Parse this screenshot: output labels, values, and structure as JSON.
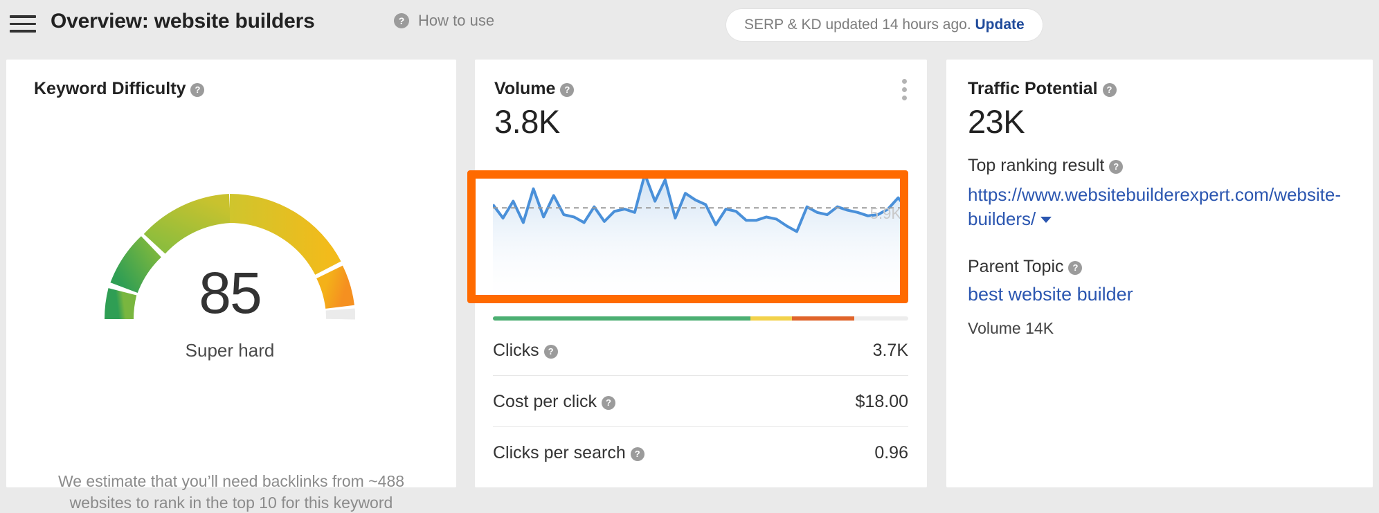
{
  "header": {
    "menu_icon": "hamburger-icon",
    "title": "Overview: website builders",
    "help_icon": "question-mark-icon",
    "how_to_use": "How to use",
    "update_text": "SERP & KD updated 14 hours ago.",
    "update_link": "Update",
    "update_link_color": "#204b9b"
  },
  "keyword_difficulty": {
    "title": "Keyword Difficulty",
    "help_icon": "question-mark-icon",
    "score": "85",
    "score_label": "Super hard",
    "footer": "We estimate that you’ll need backlinks from ~488 websites to rank in the top 10 for this keyword",
    "gauge": {
      "value": 85,
      "min": 0,
      "max": 100,
      "colors": [
        "#3da35c",
        "#8dbf3f",
        "#d4c32c",
        "#f2b619",
        "#f5971d",
        "#ebebeb"
      ]
    }
  },
  "volume": {
    "title": "Volume",
    "help_icon": "question-mark-icon",
    "value": "3.8K",
    "menu_icon": "kebab-menu-icon",
    "axis_max_label": "5.9K",
    "serp_segments": [
      {
        "color": "#4caf72",
        "pct": 62
      },
      {
        "color": "#f2d24b",
        "pct": 10
      },
      {
        "color": "#e0642a",
        "pct": 15
      },
      {
        "color": "#ededed",
        "pct": 13
      }
    ],
    "metrics": [
      {
        "label": "Clicks",
        "value": "3.7K",
        "help_icon": "question-mark-icon"
      },
      {
        "label": "Cost per click",
        "value": "$18.00",
        "help_icon": "question-mark-icon"
      },
      {
        "label": "Clicks per search",
        "value": "0.96",
        "help_icon": "question-mark-icon"
      }
    ]
  },
  "traffic_potential": {
    "title": "Traffic Potential",
    "help_icon": "question-mark-icon",
    "value": "23K",
    "top_ranking_result_label": "Top ranking result",
    "top_ranking_result_url": "https://www.websitebuilderexpert.com/website-builders/",
    "dropdown_icon": "caret-down-icon",
    "parent_topic_label": "Parent Topic",
    "parent_topic": "best website builder",
    "parent_volume": "Volume 14K"
  },
  "annotation": {
    "name": "highlight-box",
    "color": "#ff6a00"
  },
  "chart_data": {
    "type": "area",
    "title": "Volume",
    "ylabel": "",
    "xlabel": "",
    "ylim": [
      0,
      5900
    ],
    "axis_max_label": "5.9K",
    "average_line": 3800,
    "line_color": "#4a90d9",
    "fill_color": "#dce9f7",
    "grid": false,
    "legend": null,
    "values": [
      3950,
      3350,
      4100,
      3150,
      4650,
      3400,
      4350,
      3500,
      3400,
      3150,
      3850,
      3200,
      3650,
      3750,
      3600,
      5300,
      4100,
      5050,
      3350,
      4450,
      4150,
      3950,
      3050,
      3750,
      3650,
      3250,
      3250,
      3400,
      3300,
      3000,
      2750,
      3850,
      3600,
      3500,
      3850,
      3700,
      3600,
      3450,
      3500,
      3750,
      4250,
      3700
    ]
  }
}
